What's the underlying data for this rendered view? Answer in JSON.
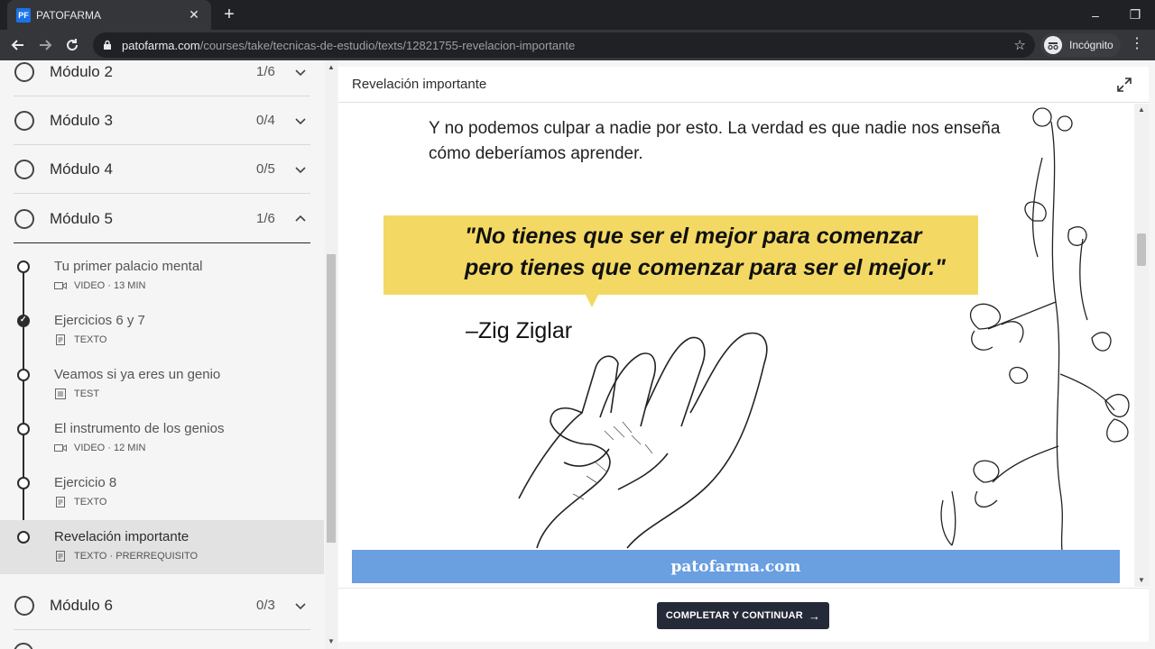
{
  "browser": {
    "tab_icon_text": "PF",
    "tab_title": "PATOFARMA",
    "tab_close": "✕",
    "new_tab": "+",
    "url_host": "patofarma.com",
    "url_path": "/courses/take/tecnicas-de-estudio/texts/12821755-revelacion-importante",
    "incognito_label": "Incógnito",
    "window_controls": [
      "–",
      "❐",
      "✕"
    ]
  },
  "sidebar": {
    "modules_top": [
      {
        "title": "Módulo 2",
        "count": "1/6",
        "state": "collapsed"
      },
      {
        "title": "Módulo 3",
        "count": "0/4",
        "state": "collapsed"
      },
      {
        "title": "Módulo 4",
        "count": "0/5",
        "state": "collapsed"
      },
      {
        "title": "Módulo 5",
        "count": "1/6",
        "state": "expanded"
      }
    ],
    "lessons": [
      {
        "title": "Tu primer palacio mental",
        "meta": "VIDEO · 13 MIN",
        "icon": "video-icon",
        "done": false,
        "active": false
      },
      {
        "title": "Ejercicios 6 y 7",
        "meta": "TEXTO",
        "icon": "document-icon",
        "done": true,
        "active": false
      },
      {
        "title": "Veamos si ya eres un genio",
        "meta": "TEST",
        "icon": "test-icon",
        "done": false,
        "active": false
      },
      {
        "title": "El instrumento de los genios",
        "meta": "VIDEO · 12 MIN",
        "icon": "video-icon",
        "done": false,
        "active": false
      },
      {
        "title": "Ejercicio 8",
        "meta": "TEXTO",
        "icon": "document-icon",
        "done": false,
        "active": false
      },
      {
        "title": "Revelación importante",
        "meta": "TEXTO · PRERREQUISITO",
        "icon": "document-icon",
        "done": false,
        "active": true
      }
    ],
    "module_bottom": {
      "title": "Módulo 6",
      "count": "0/3",
      "state": "collapsed"
    }
  },
  "content": {
    "title": "Revelación importante",
    "intro_text": "Y no podemos culpar a nadie por esto. La verdad es que nadie nos enseña cómo deberíamos aprender.",
    "quote_line1": "\"No tienes que ser el mejor para comenzar",
    "quote_line2": "pero tienes que comenzar para ser el mejor.\"",
    "quote_author": "–Zig Ziglar",
    "banner_text": "patofarma.com",
    "cta_label": "COMPLETAR Y CONTINUAR",
    "cta_arrow": "→"
  },
  "colors": {
    "quote_bg": "#f3d964",
    "banner_bg": "#6a9fe0",
    "cta_bg": "#252a38"
  }
}
